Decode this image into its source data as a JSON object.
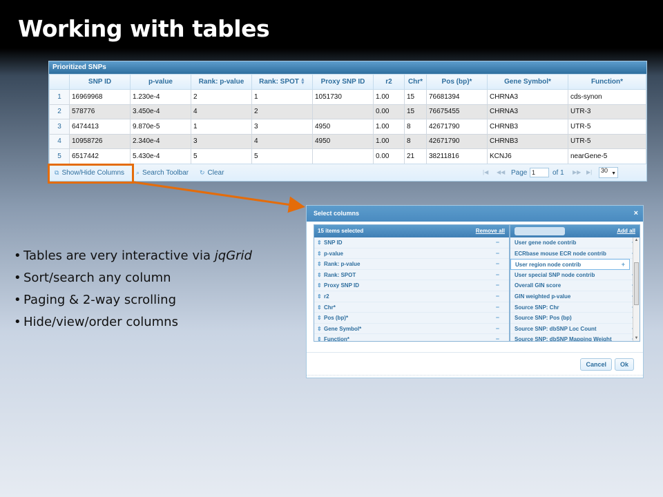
{
  "slide": {
    "title": "Working with tables",
    "bullets": [
      {
        "text": "Tables are very interactive via ",
        "emph": "jqGrid"
      },
      {
        "text": "Sort/search any column"
      },
      {
        "text": "Paging & 2-way scrolling"
      },
      {
        "text": "Hide/view/order columns"
      }
    ]
  },
  "grid": {
    "caption": "Prioritized SNPs",
    "columns": [
      "",
      "SNP ID",
      "p-value",
      "Rank: p-value",
      "Rank: SPOT",
      "Proxy SNP ID",
      "r2",
      "Chr*",
      "Pos (bp)*",
      "Gene Symbol*",
      "Function*"
    ],
    "rows": [
      [
        "1",
        "16969968",
        "1.230e-4",
        "2",
        "1",
        "1051730",
        "1.00",
        "15",
        "76681394",
        "CHRNA3",
        "cds-synon"
      ],
      [
        "2",
        "578776",
        "3.450e-4",
        "4",
        "2",
        "",
        "0.00",
        "15",
        "76675455",
        "CHRNA3",
        "UTR-3"
      ],
      [
        "3",
        "6474413",
        "9.870e-5",
        "1",
        "3",
        "4950",
        "1.00",
        "8",
        "42671790",
        "CHRNB3",
        "UTR-5"
      ],
      [
        "4",
        "10958726",
        "2.340e-4",
        "3",
        "4",
        "4950",
        "1.00",
        "8",
        "42671790",
        "CHRNB3",
        "UTR-5"
      ],
      [
        "5",
        "6517442",
        "5.430e-4",
        "5",
        "5",
        "",
        "0.00",
        "21",
        "38211816",
        "KCNJ6",
        "nearGene-5"
      ]
    ],
    "pager": {
      "show_hide": "Show/Hide Columns",
      "search_toolbar": "Search Toolbar",
      "clear": "Clear",
      "page_label": "Page",
      "page_value": "1",
      "of_label": "of 1",
      "rows_per_page": "30"
    },
    "colors": {
      "highlight_border": "#e46c0a",
      "header_bg": "#2e6e9e"
    }
  },
  "dialog": {
    "title": "Select columns",
    "close": "×",
    "selected_header": "15 items selected",
    "remove_all": "Remove all",
    "add_all": "Add all",
    "selected_items": [
      "SNP ID",
      "p-value",
      "Rank: p-value",
      "Rank: SPOT",
      "Proxy SNP ID",
      "r2",
      "Chr*",
      "Pos (bp)*",
      "Gene Symbol*",
      "Function*"
    ],
    "available_items": [
      "User gene node contrib",
      "ECRbase mouse ECR node contrib",
      "User region node contrib",
      "User special SNP node contrib",
      "Overall GIN score",
      "GIN weighted p-value",
      "Source SNP: Chr",
      "Source SNP: Pos (bp)",
      "Source SNP: dbSNP Loc Count",
      "Source SNP: dbSNP Mapping Weight"
    ],
    "remove_glyph": "−",
    "add_glyph": "+",
    "drag_glyph": "⇕",
    "cancel": "Cancel",
    "ok": "Ok"
  }
}
